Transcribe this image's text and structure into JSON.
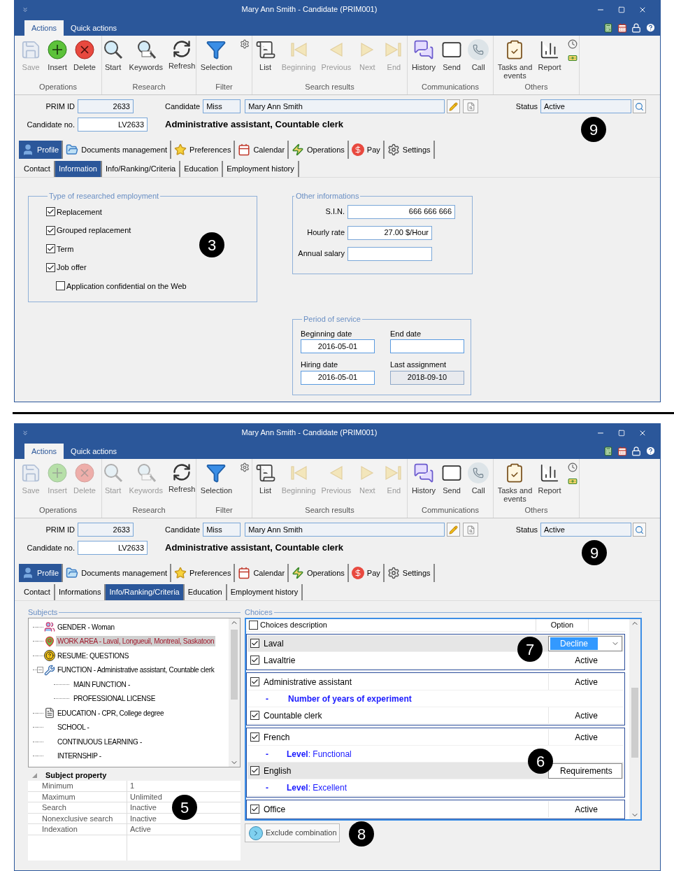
{
  "windows": [
    {
      "title": "Mary Ann Smith - Candidate (PRIM001)",
      "ribbon_tabs": [
        {
          "label": "Actions",
          "selected": true
        },
        {
          "label": "Quick actions",
          "selected": false
        }
      ],
      "ribbon_groups": [
        {
          "label": "Operations",
          "buttons": [
            {
              "label": "Save",
              "disabled": true
            },
            {
              "label": "Insert",
              "disabled": false
            },
            {
              "label": "Delete",
              "disabled": false
            }
          ]
        },
        {
          "label": "Research",
          "buttons": [
            {
              "label": "Start",
              "disabled": false
            },
            {
              "label": "Keywords",
              "disabled": false
            },
            {
              "label": "Refresh",
              "disabled": false
            }
          ]
        },
        {
          "label": "Filter",
          "buttons": [
            {
              "label": "Selection",
              "disabled": false
            }
          ]
        },
        {
          "label": "Search results",
          "buttons": [
            {
              "label": "List",
              "disabled": false
            },
            {
              "label": "Beginning",
              "disabled": true
            },
            {
              "label": "Previous",
              "disabled": true
            },
            {
              "label": "Next",
              "disabled": true
            },
            {
              "label": "End",
              "disabled": true
            }
          ]
        },
        {
          "label": "Communications",
          "buttons": [
            {
              "label": "History",
              "disabled": false
            },
            {
              "label": "Send",
              "disabled": false
            },
            {
              "label": "Call",
              "disabled": false
            }
          ]
        },
        {
          "label": "Others",
          "buttons": [
            {
              "label": "Tasks and events",
              "disabled": false
            },
            {
              "label": "Report",
              "disabled": false
            }
          ]
        }
      ],
      "header": {
        "prim_id_label": "PRIM ID",
        "prim_id": "2633",
        "candidate_label": "Candidate",
        "salutation": "Miss",
        "name": "Mary Ann Smith",
        "status_label": "Status",
        "status": "Active",
        "candidate_no_label": "Candidate no.",
        "candidate_no": "LV2633",
        "functions": "Administrative assistant, Countable clerk"
      },
      "main_tabs": [
        {
          "label": "Profile",
          "selected": true
        },
        {
          "label": "Documents management",
          "selected": false
        },
        {
          "label": "Preferences",
          "selected": false
        },
        {
          "label": "Calendar",
          "selected": false
        },
        {
          "label": "Operations",
          "selected": false
        },
        {
          "label": "Pay",
          "selected": false
        },
        {
          "label": "Settings",
          "selected": false
        }
      ],
      "sub_tabs": [
        {
          "label": "Contact",
          "selected": false
        },
        {
          "label": "Information",
          "selected": true
        },
        {
          "label": "Info/Ranking/Criteria",
          "selected": false
        },
        {
          "label": "Education",
          "selected": false
        },
        {
          "label": "Employment history",
          "selected": false
        }
      ],
      "content": {
        "kind": "information",
        "employment": {
          "title": "Type of researched employment",
          "options": [
            {
              "label": "Replacement",
              "checked": true
            },
            {
              "label": "Grouped replacement",
              "checked": true
            },
            {
              "label": "Term",
              "checked": true
            },
            {
              "label": "Job offer",
              "checked": true,
              "children": [
                {
                  "label": "Application confidential on the Web",
                  "checked": false
                }
              ]
            }
          ]
        },
        "other": {
          "title": "Other informations",
          "fields": [
            {
              "label": "S.I.N.",
              "value": "666 666 666"
            },
            {
              "label": "Hourly rate",
              "value": "27.00 $/Hour"
            },
            {
              "label": "Annual salary"
            }
          ]
        },
        "service": {
          "title": "Period of service",
          "fields": [
            {
              "label": "Beginning date",
              "value": "2016-05-01",
              "disabled": false
            },
            {
              "label": "End date",
              "disabled": false
            },
            {
              "label": "Hiring date",
              "value": "2016-05-01",
              "disabled": false
            },
            {
              "label": "Last assignment",
              "value": "2018-09-10",
              "disabled": true
            }
          ]
        }
      },
      "callouts": [
        {
          "label": "9"
        },
        {
          "label": "3"
        }
      ]
    },
    {
      "title": "Mary Ann Smith - Candidate (PRIM001)",
      "ribbon_tabs": [
        {
          "label": "Actions",
          "selected": true
        },
        {
          "label": "Quick actions",
          "selected": false
        }
      ],
      "ribbon_groups": [
        {
          "label": "Operations",
          "buttons": [
            {
              "label": "Save",
              "disabled": true
            },
            {
              "label": "Insert",
              "disabled": true
            },
            {
              "label": "Delete",
              "disabled": true
            }
          ]
        },
        {
          "label": "Research",
          "buttons": [
            {
              "label": "Start",
              "disabled": true
            },
            {
              "label": "Keywords",
              "disabled": true
            },
            {
              "label": "Refresh",
              "disabled": false
            }
          ]
        },
        {
          "label": "Filter",
          "buttons": [
            {
              "label": "Selection",
              "disabled": false
            }
          ]
        },
        {
          "label": "Search results",
          "buttons": [
            {
              "label": "List",
              "disabled": false
            },
            {
              "label": "Beginning",
              "disabled": true
            },
            {
              "label": "Previous",
              "disabled": true
            },
            {
              "label": "Next",
              "disabled": true
            },
            {
              "label": "End",
              "disabled": true
            }
          ]
        },
        {
          "label": "Communications",
          "buttons": [
            {
              "label": "History",
              "disabled": false
            },
            {
              "label": "Send",
              "disabled": false
            },
            {
              "label": "Call",
              "disabled": false
            }
          ]
        },
        {
          "label": "Others",
          "buttons": [
            {
              "label": "Tasks and events",
              "disabled": false
            },
            {
              "label": "Report",
              "disabled": false
            }
          ]
        }
      ],
      "header": {
        "prim_id_label": "PRIM ID",
        "prim_id": "2633",
        "candidate_label": "Candidate",
        "salutation": "Miss",
        "name": "Mary Ann Smith",
        "status_label": "Status",
        "status": "Active",
        "candidate_no_label": "Candidate no.",
        "candidate_no": "LV2633",
        "functions": "Administrative assistant, Countable clerk"
      },
      "main_tabs": [
        {
          "label": "Profile",
          "selected": true
        },
        {
          "label": "Documents management",
          "selected": false
        },
        {
          "label": "Preferences",
          "selected": false
        },
        {
          "label": "Calendar",
          "selected": false
        },
        {
          "label": "Operations",
          "selected": false
        },
        {
          "label": "Pay",
          "selected": false
        },
        {
          "label": "Settings",
          "selected": false
        }
      ],
      "sub_tabs": [
        {
          "label": "Contact",
          "selected": false
        },
        {
          "label": "Informations",
          "selected": false
        },
        {
          "label": "Info/Ranking/Criteria",
          "selected": true
        },
        {
          "label": "Education",
          "selected": false
        },
        {
          "label": "Employment history",
          "selected": false
        }
      ],
      "content": {
        "kind": "criteria",
        "subjects": {
          "title": "Subjects",
          "tree": [
            {
              "label": "GENDER - Woman",
              "selected": false
            },
            {
              "label": "WORK AREA - Laval, Longueuil, Montreal, Saskatoon",
              "selected": true
            },
            {
              "label": "RESUME: QUESTIONS",
              "selected": false
            },
            {
              "label": "FUNCTION - Administrative assistant, Countable clerk",
              "selected": false,
              "expanded": true,
              "children": [
                {
                  "label": "MAIN FUNCTION -",
                  "selected": false
                },
                {
                  "label": "PROFESSIONAL LICENSE",
                  "selected": false
                }
              ]
            },
            {
              "label": "EDUCATION - CPR, College degree",
              "selected": false
            },
            {
              "label": "SCHOOL -",
              "selected": false
            },
            {
              "label": "CONTINUOUS LEARNING -",
              "selected": false
            },
            {
              "label": "INTERNSHIP -",
              "selected": false
            }
          ],
          "property_title": "Subject property",
          "properties": [
            {
              "name": "Minimum",
              "value": "1"
            },
            {
              "name": "Maximum",
              "value": "Unlimited"
            },
            {
              "name": "Search",
              "value": "Inactive"
            },
            {
              "name": "Nonexclusive search",
              "value": "Inactive"
            },
            {
              "name": "Indexation",
              "value": "Active"
            }
          ]
        },
        "choices": {
          "title": "Choices",
          "header": {
            "checked": false,
            "description": "Choices description",
            "option": "Option"
          },
          "groups": [
            {
              "rows": [
                {
                  "kind": "choice",
                  "label": "Laval",
                  "checked": true,
                  "selected": true,
                  "option": {
                    "kind": "dropdown",
                    "value": "Decline",
                    "highlighted": true
                  }
                },
                {
                  "kind": "choice",
                  "label": "Lavaltrie",
                  "checked": true,
                  "selected": false,
                  "option": {
                    "kind": "text",
                    "value": "Active"
                  }
                }
              ]
            },
            {
              "rows": [
                {
                  "kind": "choice",
                  "label": "Administrative assistant",
                  "checked": true,
                  "selected": false,
                  "option": {
                    "kind": "text",
                    "value": "Active"
                  }
                },
                {
                  "kind": "criterion",
                  "bullet": "-",
                  "text": "Number of years of experiment"
                },
                {
                  "kind": "choice",
                  "label": "Countable clerk",
                  "checked": true,
                  "selected": false,
                  "option": {
                    "kind": "text",
                    "value": "Active"
                  }
                }
              ]
            },
            {
              "rows": [
                {
                  "kind": "choice",
                  "label": "French",
                  "checked": true,
                  "selected": false,
                  "option": {
                    "kind": "text",
                    "value": "Active"
                  }
                },
                {
                  "kind": "level",
                  "bullet": "-",
                  "text": "**Level**: Functional"
                },
                {
                  "kind": "choice",
                  "label": "English",
                  "checked": true,
                  "selected": true,
                  "option": {
                    "kind": "dropdown",
                    "value": "Requirements",
                    "highlighted": false
                  }
                },
                {
                  "kind": "level",
                  "bullet": "-",
                  "text": "**Level**: Excellent"
                }
              ]
            },
            {
              "rows": [
                {
                  "kind": "choice",
                  "label": "Office",
                  "checked": true,
                  "selected": false,
                  "option": {
                    "kind": "text",
                    "value": "Active"
                  }
                }
              ]
            }
          ]
        },
        "exclude_button": "Exclude combination"
      },
      "callouts": [
        {
          "label": "9"
        },
        {
          "label": "7"
        },
        {
          "label": "6"
        },
        {
          "label": "5"
        },
        {
          "label": "8"
        }
      ]
    }
  ]
}
